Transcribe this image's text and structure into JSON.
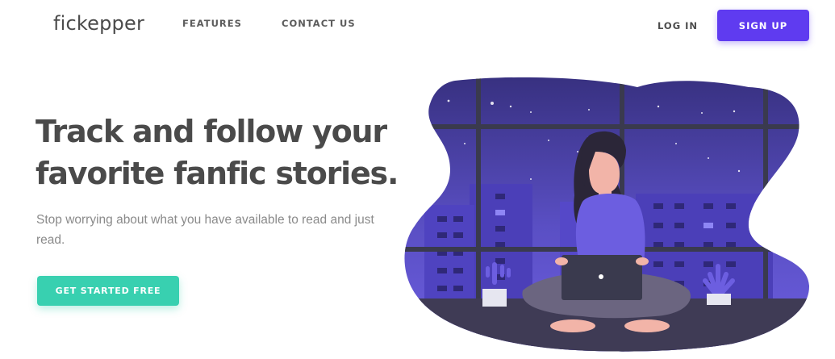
{
  "header": {
    "logo": "fickepper",
    "nav": {
      "features": "FEATURES",
      "contact": "CONTACT US"
    },
    "login": "LOG IN",
    "signup": "SIGN UP"
  },
  "hero": {
    "headline": "Track and follow your favorite fanfic stories.",
    "subtext": "Stop worrying about what you have available to read and just read.",
    "cta": "GET STARTED FREE"
  },
  "colors": {
    "accent": "#5f3bf0",
    "cta": "#38d0b0",
    "heading": "#4a4a4a",
    "muted": "#8a8a8a"
  }
}
